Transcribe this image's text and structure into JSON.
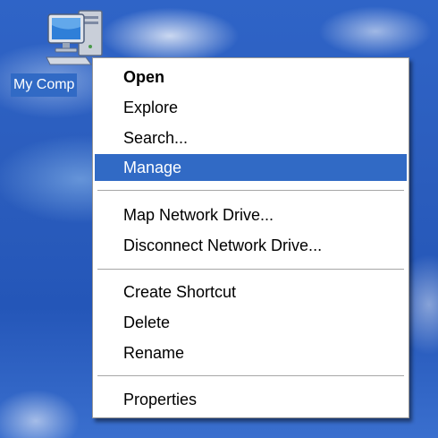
{
  "desktop": {
    "icon": {
      "name": "computer-icon",
      "label": "My Comp"
    }
  },
  "context_menu": {
    "items": [
      {
        "label": "Open",
        "bold": true
      },
      {
        "label": "Explore"
      },
      {
        "label": "Search..."
      },
      {
        "label": "Manage",
        "highlighted": true
      },
      {
        "label": "Map Network Drive..."
      },
      {
        "label": "Disconnect Network Drive..."
      },
      {
        "label": "Create Shortcut"
      },
      {
        "label": "Delete"
      },
      {
        "label": "Rename"
      },
      {
        "label": "Properties"
      }
    ]
  },
  "colors": {
    "selection": "#316ac5",
    "desktop_blue": "#2b5dbd",
    "menu_background": "#ffffff"
  }
}
